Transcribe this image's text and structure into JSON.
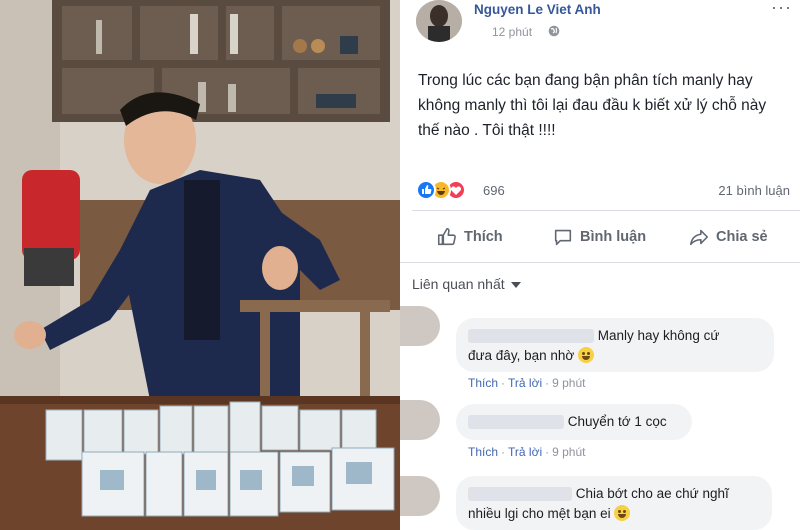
{
  "post": {
    "author": "Nguyen Le Viet Anh",
    "time": "12 phút",
    "text": "Trong lúc các bạn đang bận phân tích manly hay không manly thì tôi lại đau đầu k biết xử lý chỗ này thế nào . Tôi thật !!!!",
    "more_label": "···"
  },
  "stats": {
    "reactions": [
      "like-icon",
      "haha-icon",
      "love-icon"
    ],
    "reaction_count": "696",
    "comment_count": "21 bình luận"
  },
  "actions": {
    "like": "Thích",
    "comment": "Bình luận",
    "share": "Chia sẻ"
  },
  "filter": {
    "label": "Liên quan nhất"
  },
  "comments": [
    {
      "text_line1": "Manly hay không cứ",
      "text_line2": "đưa đây, bạn nhờ",
      "like": "Thích",
      "reply": "Trả lời",
      "time": "9 phút"
    },
    {
      "text_line1": "Chuyển tớ 1 cọc",
      "like": "Thích",
      "reply": "Trả lời",
      "time": "9 phút"
    },
    {
      "text_line1": "Chia bớt cho ae chứ nghĩ",
      "text_line2": "nhiều lgi cho mệt bạn ei"
    }
  ],
  "colors": {
    "link": "#365899",
    "muted": "#90949c",
    "bubble": "#f2f3f5",
    "accent": "#4267b2"
  }
}
